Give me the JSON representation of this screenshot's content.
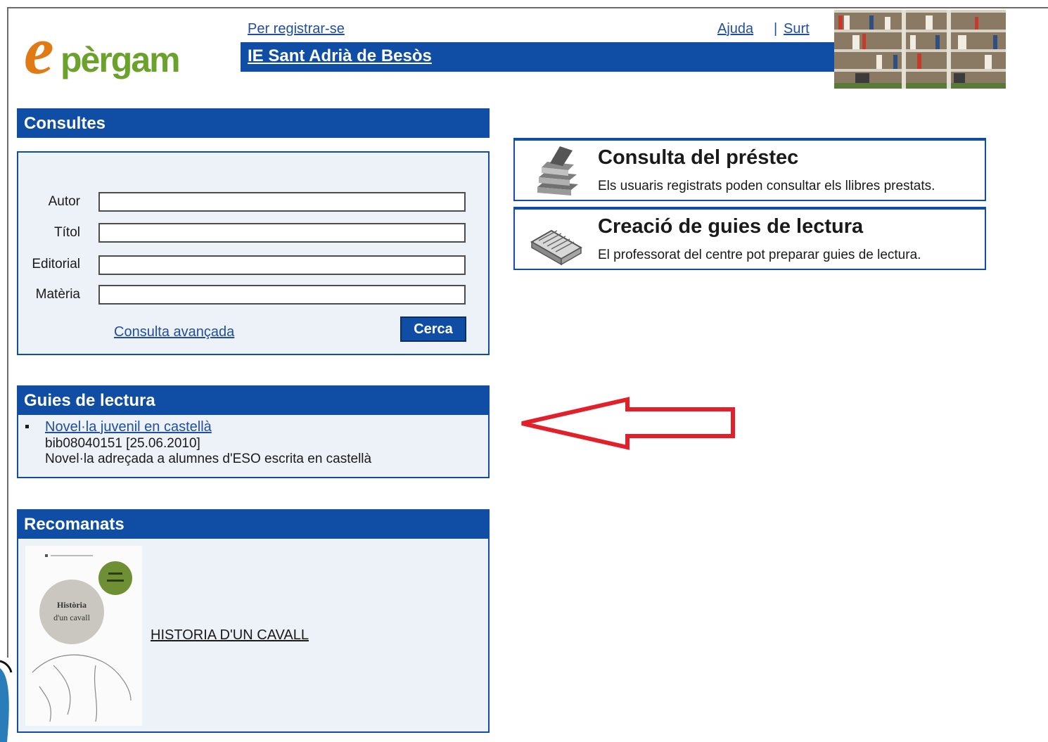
{
  "header": {
    "register_link": "Per registrar-se",
    "help_link": "Ajuda",
    "separator": "|",
    "exit_link": "Surt",
    "site_title": "IE Sant Adrià de Besòs",
    "logo_text": "epèrgam"
  },
  "search": {
    "heading": "Consultes",
    "fields": [
      {
        "label": "Autor",
        "value": ""
      },
      {
        "label": "Títol",
        "value": ""
      },
      {
        "label": "Editorial",
        "value": ""
      },
      {
        "label": "Matèria",
        "value": ""
      }
    ],
    "advanced_link": "Consulta avançada",
    "search_button": "Cerca"
  },
  "guides": {
    "heading": "Guies de lectura",
    "items": [
      {
        "title": "Novel·la juvenil en castellà",
        "meta": "bib08040151 [25.06.2010]",
        "description": "Novel·la adreçada a alumnes d'ESO escrita en castellà"
      }
    ]
  },
  "recommended": {
    "heading": "Recomanats",
    "items": [
      {
        "title": "HISTORIA D'UN CAVALL",
        "cover_text": "Història d'un cavall"
      }
    ]
  },
  "cards": [
    {
      "title": "Consulta del préstec",
      "description": "Els usuaris registrats poden consultar els llibres prestats.",
      "icon": "books-stack-icon"
    },
    {
      "title": "Creació de guies de lectura",
      "description": "El professorat del centre pot preparar guies de lectura.",
      "icon": "open-book-icon"
    }
  ],
  "colors": {
    "brand_blue": "#0f4ea4",
    "panel_bg": "#edf2f9",
    "arrow_red": "#e3202a",
    "logo_orange": "#e27a14",
    "logo_green": "#6ba22c"
  }
}
